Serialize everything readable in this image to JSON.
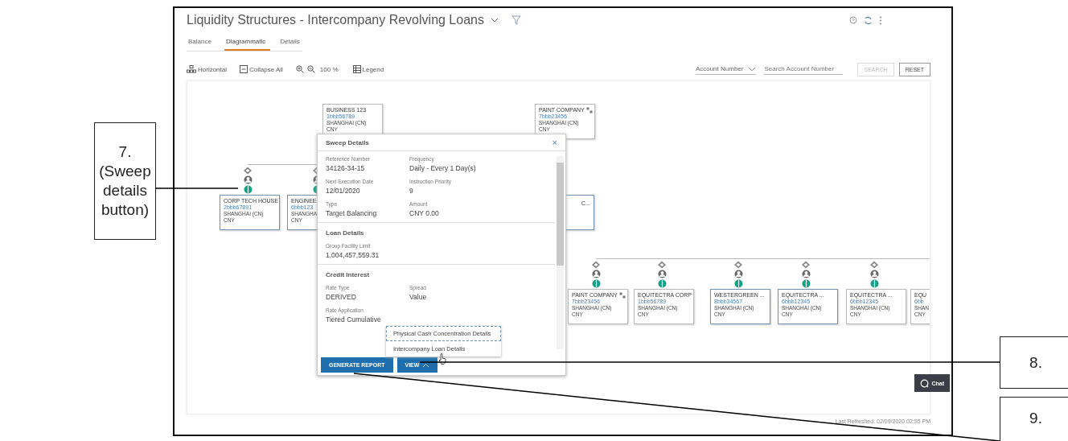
{
  "callouts": [
    {
      "number": "7.",
      "caption": "(Sweep details button)"
    },
    {
      "number": "8."
    },
    {
      "number": "9."
    }
  ],
  "header": {
    "title": "Liquidity Structures - Intercompany Revolving Loans"
  },
  "tabs": [
    {
      "label": "Balance",
      "selected": false
    },
    {
      "label": "Diagrammatic",
      "selected": true
    },
    {
      "label": "Details",
      "selected": false
    }
  ],
  "toolbar": {
    "layout": "Horizontal",
    "collapse": "Collapse All",
    "zoom": "100 %",
    "legend": "Legend"
  },
  "search": {
    "field": "Account Number",
    "placeholder": "Search Account Number",
    "buttons": [
      {
        "label": "SEARCH",
        "disabled": true
      },
      {
        "label": "RESET",
        "disabled": false
      }
    ]
  },
  "nodes": [
    {
      "name": "BUSINESS 123",
      "account": "1bbb56789",
      "location": "SHANGHAI (CN)",
      "currency": "CNY",
      "outlined": false,
      "linked": false
    },
    {
      "name": "PAINT COMPANY",
      "account": "7bbb23456",
      "location": "SHANGHAI (CN)",
      "currency": "CNY",
      "outlined": false,
      "linked": true
    },
    {
      "name": "CORP TECH HOUSE",
      "account": "2bbb67891",
      "location": "SHANGHAI (CN)",
      "currency": "CNY",
      "outlined": true,
      "linked": false
    },
    {
      "name": "ENGINEE",
      "account": "6bbb123",
      "location": "SHANGHA",
      "currency": "CNY",
      "outlined": true,
      "linked": false
    },
    {
      "name": "C...",
      "outlined": true,
      "linked": false
    },
    {
      "name": "PAINT COMPANY",
      "account": "7bbb23456",
      "location": "SHANGHAI (CN)",
      "currency": "CNY",
      "outlined": false,
      "linked": true
    },
    {
      "name": "EQUITECTRA CORP",
      "account": "1bbb56789",
      "location": "SHANGHAI (CN)",
      "currency": "CNY",
      "outlined": false,
      "linked": false
    },
    {
      "name": "WESTERGREEN ...",
      "account": "8bbb34567",
      "location": "SHANGHAI (CN)",
      "currency": "CNY",
      "outlined": true,
      "linked": false
    },
    {
      "name": "EQUITECTRA ...",
      "account": "6bbb12345",
      "location": "SHANGHAI (CN)",
      "currency": "CNY",
      "outlined": true,
      "linked": false
    },
    {
      "name": "EQUITECTRA ...",
      "account": "6bbb12345",
      "location": "SHANGHAI (CN)",
      "currency": "CNY",
      "outlined": false,
      "linked": false
    },
    {
      "name": "EQU",
      "account": "6bb",
      "location": "SHAN",
      "currency": "CNY",
      "outlined": false,
      "linked": false
    }
  ],
  "popup": {
    "title": "Sweep Details",
    "close": "×",
    "sections": [
      {
        "fields": [
          {
            "label": "Reference Number",
            "value": "34126-34-15"
          },
          {
            "label": "Frequency",
            "value": "Daily - Every 1 Day(s)"
          },
          {
            "label": "Next Execution Date",
            "value": "12/01/2020"
          },
          {
            "label": "Instruction Priority",
            "value": "9"
          },
          {
            "label": "Type",
            "value": "Target Balancing"
          },
          {
            "label": "Amount",
            "value": "CNY 0.00"
          }
        ]
      },
      {
        "title": "Loan Details",
        "fields": [
          {
            "label": "Group Facility Limit",
            "value": "1,004,457,559.31"
          }
        ]
      },
      {
        "title": "Credit Interest",
        "fields": [
          {
            "label": "Rate Type",
            "value": "DERIVED"
          },
          {
            "label": "Spread",
            "value": "Value"
          },
          {
            "label": "Rate Application",
            "value": "Tiered Cumulative"
          }
        ]
      }
    ],
    "menu": [
      {
        "label": "Physical Cash Concentration Details",
        "focused": true
      },
      {
        "label": "Intercompany Loan Details",
        "focused": false
      }
    ],
    "buttons": [
      {
        "label": "GENERATE REPORT",
        "kind": "plain"
      },
      {
        "label": "VIEW",
        "kind": "menu"
      }
    ]
  },
  "chat": "Chat",
  "last_refreshed": "Last Refreshed: 02/09/2020 02:55 PM"
}
